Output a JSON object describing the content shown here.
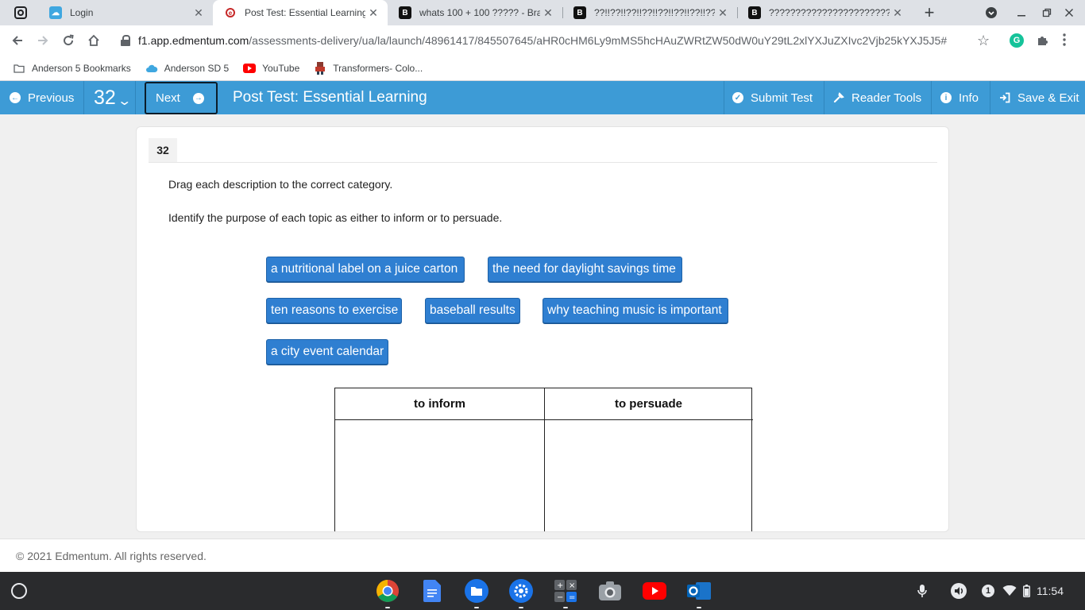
{
  "browser": {
    "tabs": [
      {
        "title": "Login",
        "favicon": "cloud-icon",
        "active": false
      },
      {
        "title": "Post Test: Essential Learning",
        "favicon": "edmentum-icon",
        "active": true
      },
      {
        "title": "whats 100 + 100 ????? - Brai",
        "favicon": "brainly-icon",
        "active": false
      },
      {
        "title": "??!!??!!??!!??!!??!!??!!??!!??",
        "favicon": "brainly-icon",
        "active": false
      },
      {
        "title": "?????????????????????????",
        "favicon": "brainly-icon",
        "active": false
      }
    ],
    "url_host": "f1.app.edmentum.com",
    "url_path": "/assessments-delivery/ua/la/launch/48961417/845507645/aHR0cHM6Ly9mMS5hcHAuZWRtZW50dW0uY29tL2xlYXJuZXIvc2Vjb25kYXJ5J5#",
    "bookmarks": [
      {
        "label": "Anderson 5 Bookmarks",
        "icon": "folder-icon"
      },
      {
        "label": "Anderson SD 5",
        "icon": "cloud-icon"
      },
      {
        "label": "YouTube",
        "icon": "youtube-icon"
      },
      {
        "label": "Transformers- Colo...",
        "icon": "transformer-icon"
      }
    ]
  },
  "header": {
    "previous_label": "Previous",
    "question_number": "32",
    "next_label": "Next",
    "test_title": "Post Test: Essential Learning",
    "submit_label": "Submit Test",
    "reader_tools_label": "Reader Tools",
    "info_label": "Info",
    "save_exit_label": "Save & Exit"
  },
  "question": {
    "number": "32",
    "instruction": "Drag each description to the correct category.",
    "prompt": "Identify the purpose of each topic as either to inform or to persuade.",
    "items": [
      "a nutritional label on a juice carton",
      "the need for daylight savings time",
      "ten reasons to exercise",
      "baseball results",
      "why teaching music is important",
      "a city event calendar"
    ],
    "categories": [
      "to inform",
      "to persuade"
    ]
  },
  "footer": {
    "copyright": "© 2021 Edmentum. All rights reserved."
  },
  "shelf": {
    "apps": [
      "chrome-icon",
      "docs-icon",
      "files-icon",
      "settings-icon",
      "calculator-icon",
      "camera-icon",
      "youtube-icon",
      "outlook-icon"
    ],
    "notification_count": "1",
    "time": "11:54"
  },
  "colors": {
    "edmentum_blue": "#3d9bd6",
    "chip_blue": "#2f7fd1"
  }
}
